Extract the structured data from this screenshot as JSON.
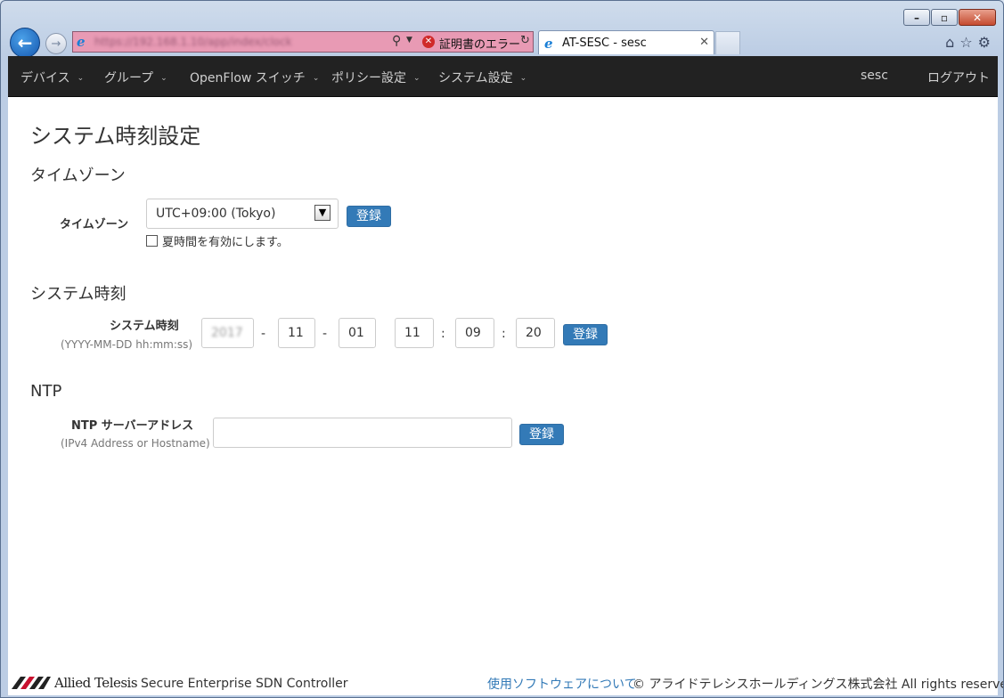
{
  "browser": {
    "window_controls": {
      "minimize": "–",
      "maximize": "▫",
      "close": "✕"
    },
    "address_url": "https://192.168.1.10/app/index/clock",
    "cert_error_label": "証明書のエラー",
    "tab_title": "AT-SESC - sesc",
    "tab_close": "✕"
  },
  "navbar": {
    "items": [
      {
        "label": "デバイス",
        "caret": "⌄"
      },
      {
        "label": "グループ",
        "caret": "⌄"
      },
      {
        "label": "OpenFlow スイッチ",
        "caret": "⌄"
      },
      {
        "label": "ポリシー設定",
        "caret": "⌄"
      },
      {
        "label": "システム設定",
        "caret": "⌄"
      }
    ],
    "user": "sesc",
    "logout": "ログアウト"
  },
  "page": {
    "title": "システム時刻設定",
    "timezone": {
      "heading": "タイムゾーン",
      "label": "タイムゾーン",
      "selected": "UTC+09:00 (Tokyo)",
      "register": "登録",
      "dst_label": "夏時間を有効にします。"
    },
    "clock": {
      "heading": "システム時刻",
      "label": "システム時刻",
      "format_hint": "(YYYY-MM-DD hh:mm:ss)",
      "year": "2017",
      "month": "11",
      "day": "01",
      "hour": "11",
      "minute": "09",
      "second": "20",
      "date_sep": "-",
      "time_sep": ":",
      "register": "登録"
    },
    "ntp": {
      "heading": "NTP",
      "label": "NTP サーバーアドレス",
      "hint": "(IPv4 Address or Hostname)",
      "value": "",
      "register": "登録"
    }
  },
  "footer": {
    "logo_text": "Allied Telesis",
    "product": "Secure Enterprise SDN Controller",
    "oss_link": "使用ソフトウェアについて",
    "copyright": "© アライドテレシスホールディングス株式会社 All rights reserved."
  },
  "colors": {
    "navbar_bg": "#222222",
    "primary_button": "#337ab7",
    "link": "#337ab7",
    "address_error_bg": "#e89ab4"
  }
}
